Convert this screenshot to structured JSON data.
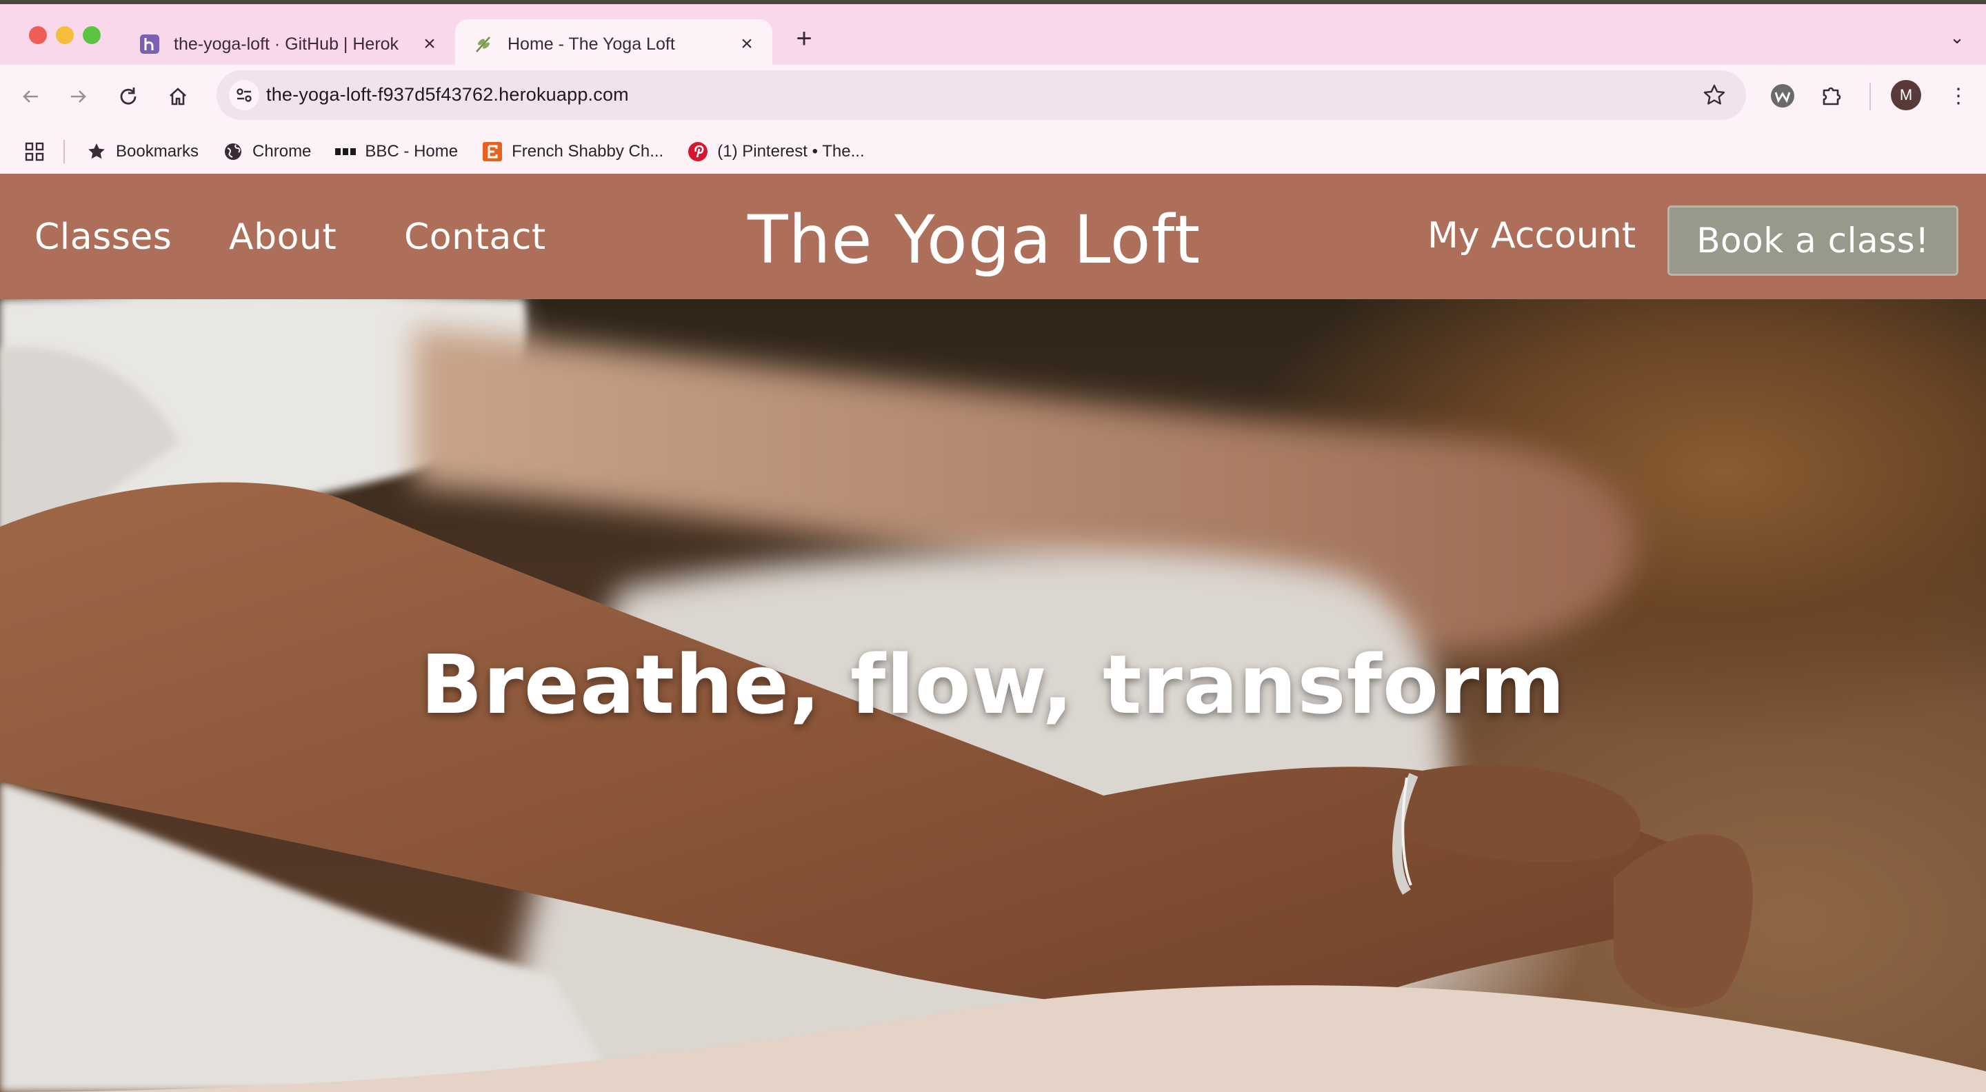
{
  "browser": {
    "tabs": [
      {
        "title": "the-yoga-loft · GitHub | Herok",
        "favicon": "heroku-icon",
        "active": false
      },
      {
        "title": "Home - The Yoga Loft",
        "favicon": "leaf-icon",
        "active": true
      }
    ],
    "url": "the-yoga-loft-f937d5f43762.herokuapp.com",
    "profile_initial": "M",
    "bookmarks": [
      {
        "label": "Bookmarks",
        "icon": "star-icon"
      },
      {
        "label": "Chrome",
        "icon": "globe-icon"
      },
      {
        "label": "BBC - Home",
        "icon": "bbc-icon"
      },
      {
        "label": "French Shabby Ch...",
        "icon": "etsy-icon"
      },
      {
        "label": "(1) Pinterest • The...",
        "icon": "pinterest-icon"
      }
    ]
  },
  "site": {
    "nav": {
      "classes": "Classes",
      "about": "About",
      "contact": "Contact"
    },
    "brand": "The Yoga Loft",
    "account": "My Account",
    "book_button": "Book a class!",
    "hero_title": "Breathe, flow, transform"
  },
  "colors": {
    "header": "#ad6e5a",
    "book_button": "#98998b",
    "tabstrip": "#f9d8ec",
    "wave": "#e4d3c6"
  }
}
